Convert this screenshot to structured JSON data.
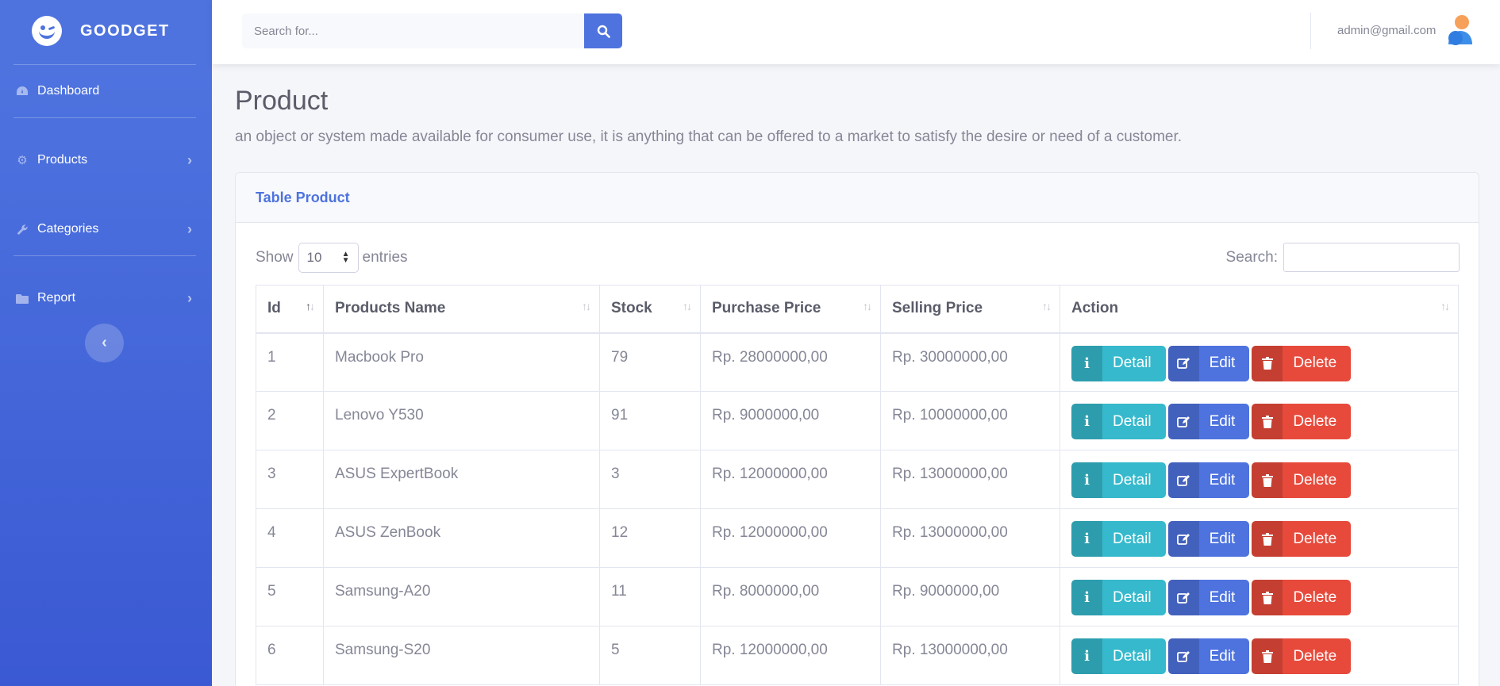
{
  "brand": {
    "name": "GOODGET"
  },
  "sidebar": {
    "items": [
      {
        "label": "Dashboard",
        "icon": "tachometer-icon"
      },
      {
        "label": "Products",
        "icon": "gear-icon"
      },
      {
        "label": "Categories",
        "icon": "wrench-icon"
      },
      {
        "label": "Report",
        "icon": "folder-icon"
      }
    ]
  },
  "topbar": {
    "search_placeholder": "Search for...",
    "user_email": "admin@gmail.com"
  },
  "page": {
    "title": "Product",
    "description": "an object or system made available for consumer use, it is anything that can be offered to a market to satisfy the desire or need of a customer."
  },
  "card": {
    "title": "Table Product",
    "show_label": "Show",
    "entries_value": "10",
    "entries_label": "entries",
    "search_label": "Search:"
  },
  "table": {
    "columns": [
      "Id",
      "Products Name",
      "Stock",
      "Purchase Price",
      "Selling Price",
      "Action"
    ],
    "rows": [
      [
        "1",
        "Macbook Pro",
        "79",
        "Rp. 28000000,00",
        "Rp. 30000000,00"
      ],
      [
        "2",
        "Lenovo Y530",
        "91",
        "Rp. 9000000,00",
        "Rp. 10000000,00"
      ],
      [
        "3",
        "ASUS ExpertBook",
        "3",
        "Rp. 12000000,00",
        "Rp. 13000000,00"
      ],
      [
        "4",
        "ASUS ZenBook",
        "12",
        "Rp. 12000000,00",
        "Rp. 13000000,00"
      ],
      [
        "5",
        "Samsung-A20",
        "11",
        "Rp. 8000000,00",
        "Rp. 9000000,00"
      ],
      [
        "6",
        "Samsung-S20",
        "5",
        "Rp. 12000000,00",
        "Rp. 13000000,00"
      ]
    ],
    "actions": {
      "detail": "Detail",
      "edit": "Edit",
      "delete": "Delete"
    }
  },
  "colors": {
    "primary": "#4e73df",
    "info": "#36b9cc",
    "danger": "#e74a3b"
  }
}
